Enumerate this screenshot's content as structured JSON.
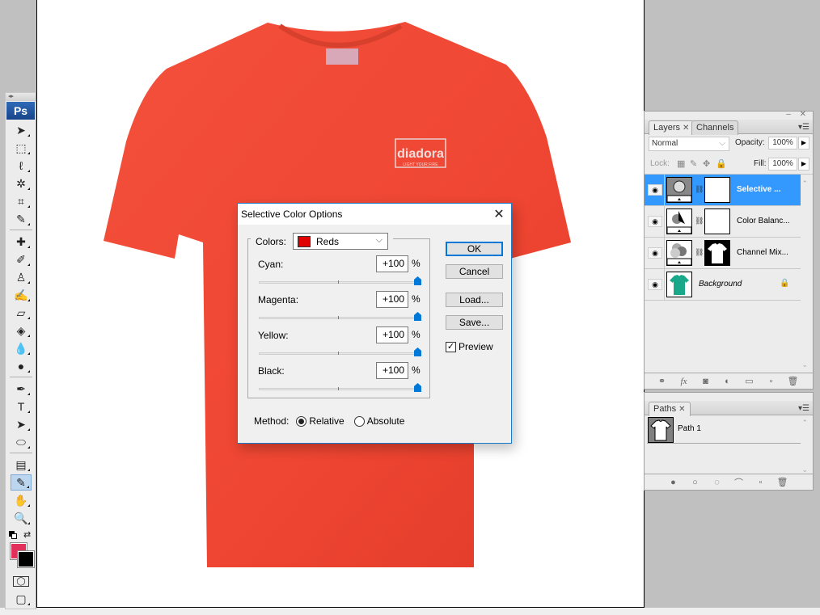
{
  "app": {
    "name": "Photoshop",
    "logo": "Ps"
  },
  "toolbox": {
    "tools": [
      {
        "name": "move-tool",
        "glyph": "➤"
      },
      {
        "name": "marquee-tool",
        "glyph": "⬚"
      },
      {
        "name": "lasso-tool",
        "glyph": "ℓ"
      },
      {
        "name": "magic-wand-tool",
        "glyph": "✲"
      },
      {
        "name": "crop-tool",
        "glyph": "⌗"
      },
      {
        "name": "slice-tool",
        "glyph": "✎"
      },
      {
        "name": "healing-brush-tool",
        "glyph": "✚"
      },
      {
        "name": "brush-tool",
        "glyph": "✐"
      },
      {
        "name": "clone-stamp-tool",
        "glyph": "♙"
      },
      {
        "name": "history-brush-tool",
        "glyph": "✍"
      },
      {
        "name": "eraser-tool",
        "glyph": "▱"
      },
      {
        "name": "paint-bucket-tool",
        "glyph": "◈"
      },
      {
        "name": "blur-tool",
        "glyph": "💧"
      },
      {
        "name": "dodge-tool",
        "glyph": "●"
      },
      {
        "name": "pen-tool",
        "glyph": "✒"
      },
      {
        "name": "type-tool",
        "glyph": "T"
      },
      {
        "name": "path-selection-tool",
        "glyph": "➤"
      },
      {
        "name": "shape-tool",
        "glyph": "⬭"
      },
      {
        "name": "notes-tool",
        "glyph": "▤"
      },
      {
        "name": "eyedropper-tool",
        "glyph": "✎"
      },
      {
        "name": "hand-tool",
        "glyph": "✋"
      },
      {
        "name": "zoom-tool",
        "glyph": "🔍"
      }
    ],
    "foreground_color": "#e3305a",
    "background_color": "#000000",
    "quick_mask_glyph": "◯",
    "screen_mode_glyph": "▢"
  },
  "canvas": {
    "image": "red t-shirt",
    "shirt_color": "#f04a38",
    "logo_text": "diadora",
    "logo_tagline": "LIGHT YOUR FIRE"
  },
  "dialog": {
    "title": "Selective Color Options",
    "colors_label": "Colors:",
    "colors_value": "Reds",
    "colors_swatch": "#e00000",
    "sliders": [
      {
        "label": "Cyan:",
        "value": "+100",
        "unit": "%",
        "percent": 100
      },
      {
        "label": "Magenta:",
        "value": "+100",
        "unit": "%",
        "percent": 100
      },
      {
        "label": "Yellow:",
        "value": "+100",
        "unit": "%",
        "percent": 100
      },
      {
        "label": "Black:",
        "value": "+100",
        "unit": "%",
        "percent": 100
      }
    ],
    "buttons": {
      "ok": "OK",
      "cancel": "Cancel",
      "load": "Load...",
      "save": "Save..."
    },
    "preview_label": "Preview",
    "preview_checked": true,
    "method_label": "Method:",
    "method_options": [
      "Relative",
      "Absolute"
    ],
    "method_selected": "Relative",
    "accent": "#0078d7"
  },
  "layers_panel": {
    "tabs": [
      {
        "label": "Layers",
        "closable": true
      },
      {
        "label": "Channels",
        "closable": false
      }
    ],
    "blend_mode": "Normal",
    "opacity_label": "Opacity:",
    "opacity": "100%",
    "lock_label": "Lock:",
    "fill_label": "Fill:",
    "fill": "100%",
    "layers": [
      {
        "name": "Selective ...",
        "selected": true,
        "type": "selective-color-adjustment"
      },
      {
        "name": "Color Balanc...",
        "selected": false,
        "type": "color-balance-adjustment"
      },
      {
        "name": "Channel Mix...",
        "selected": false,
        "type": "channel-mixer-adjustment"
      },
      {
        "name": "Background",
        "selected": false,
        "type": "image",
        "locked": true
      }
    ],
    "selection_color": "#3399ff"
  },
  "paths_panel": {
    "tabs": [
      {
        "label": "Paths",
        "closable": true
      }
    ],
    "paths": [
      {
        "name": "Path 1"
      }
    ]
  }
}
